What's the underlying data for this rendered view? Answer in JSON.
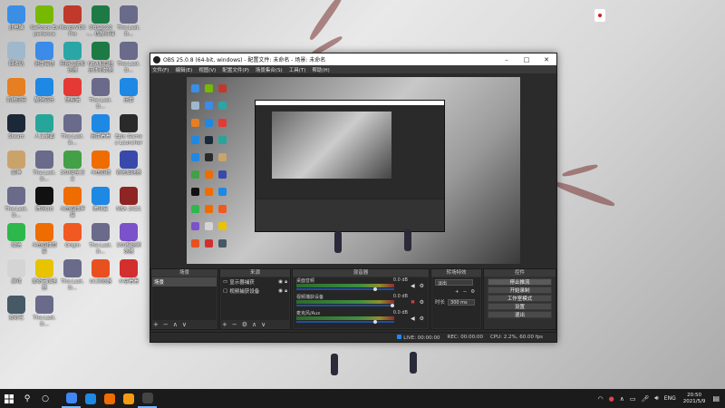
{
  "desktop": {
    "icons": [
      {
        "label": "此电脑",
        "icon": "computer-icon",
        "color": "#3a8ee6"
      },
      {
        "label": "GeForce Experience",
        "icon": "geforce-icon",
        "color": "#76b900"
      },
      {
        "label": "MorphVOX Pro",
        "icon": "morphvox-icon",
        "color": "#c0392b"
      },
      {
        "label": "OBS2020-... 优酷订阅",
        "icon": "excel-icon",
        "color": "#1d7a45"
      },
      {
        "label": "The.Last.D...",
        "icon": "file-icon",
        "color": "#6a6a8a"
      },
      {
        "label": "回收站",
        "icon": "recycle-bin-icon",
        "color": "#9fb8cc"
      },
      {
        "label": "迅雷云盘",
        "icon": "cloud-drive-icon",
        "color": "#3b8be8"
      },
      {
        "label": "阿斯力法加速器",
        "icon": "accelerator-icon",
        "color": "#2aa6a6"
      },
      {
        "label": "NBA和其他 正体测数据",
        "icon": "excel-icon",
        "color": "#1d7a45"
      },
      {
        "label": "The.Last.D...",
        "icon": "file-icon",
        "color": "#6a6a8a"
      },
      {
        "label": "系统应用",
        "icon": "system-apps-icon",
        "color": "#e67e22"
      },
      {
        "label": "酷狗音乐",
        "icon": "kugou-icon",
        "color": "#1e88e5"
      },
      {
        "label": "快剪辑",
        "icon": "video-edit-icon",
        "color": "#e53935"
      },
      {
        "label": "The.Last.D...",
        "icon": "file-icon",
        "color": "#6a6a8a"
      },
      {
        "label": "迅雷",
        "icon": "xunlei-icon",
        "color": "#1e88e5"
      },
      {
        "label": "Steam",
        "icon": "steam-icon",
        "color": "#1b2838"
      },
      {
        "label": "人工桌面",
        "icon": "desktop-theme-icon",
        "color": "#26a69a"
      },
      {
        "label": "The.Last.D...",
        "icon": "file-icon",
        "color": "#6a6a8a"
      },
      {
        "label": "迅雷看看",
        "icon": "xunlei-player-icon",
        "color": "#1e88e5"
      },
      {
        "label": "Epic Games Launcher",
        "icon": "epic-icon",
        "color": "#2a2a2a"
      },
      {
        "label": "原神",
        "icon": "genshin-icon",
        "color": "#caa36b"
      },
      {
        "label": "The.Last.D...",
        "icon": "file-icon",
        "color": "#6a6a8a"
      },
      {
        "label": "360安全卫士",
        "icon": "security-icon",
        "color": "#43a047"
      },
      {
        "label": "斗鱼直播",
        "icon": "douyu-icon",
        "color": "#ef6c00"
      },
      {
        "label": "奇迹加速器",
        "icon": "accelerator-icon",
        "color": "#3949ab"
      },
      {
        "label": "The.Last.D...",
        "icon": "file-icon",
        "color": "#6a6a8a"
      },
      {
        "label": "腾讯QQ",
        "icon": "qq-icon",
        "color": "#111111"
      },
      {
        "label": "斗鱼直播伴侣",
        "icon": "douyu-icon",
        "color": "#ef6c00"
      },
      {
        "label": "腾讯云",
        "icon": "cloud-icon",
        "color": "#1e88e5"
      },
      {
        "label": "NBA 2K21",
        "icon": "nba2k-icon",
        "color": "#8e2424"
      },
      {
        "label": "微信",
        "icon": "wechat-icon",
        "color": "#2db84b"
      },
      {
        "label": "斗鱼直播管家",
        "icon": "douyu-icon",
        "color": "#ef6c00"
      },
      {
        "label": "Origin",
        "icon": "origin-icon",
        "color": "#f05a22"
      },
      {
        "label": "The.Last.D...",
        "icon": "file-icon",
        "color": "#6a6a8a"
      },
      {
        "label": "360极速浏览器",
        "icon": "browser-icon",
        "color": "#7b52c9"
      },
      {
        "label": "游戏",
        "icon": "game-icon",
        "color": "#d4d4d4"
      },
      {
        "label": "爱奇艺加速器",
        "icon": "accelerator-icon",
        "color": "#e8c300"
      },
      {
        "label": "The.Last.D...",
        "icon": "file-icon",
        "color": "#6a6a8a"
      },
      {
        "label": "UC浏览器",
        "icon": "uc-browser-icon",
        "color": "#e9501f"
      },
      {
        "label": "小豆看看",
        "icon": "media-icon",
        "color": "#d32f2f"
      },
      {
        "label": "爱奇艺",
        "icon": "iqiyi-icon",
        "color": "#455a64"
      },
      {
        "label": "The.Last.D...",
        "icon": "file-icon",
        "color": "#6a6a8a"
      }
    ]
  },
  "obs": {
    "title": "OBS 25.0.8 (64-bit, windows) - 配置文件: 未命名 - 场景: 未命名",
    "menu": [
      "文件(F)",
      "编辑(E)",
      "视图(V)",
      "配置文件(P)",
      "场景集合(S)",
      "工具(T)",
      "帮助(H)"
    ],
    "docks": {
      "scenes": {
        "title": "场景",
        "items": [
          "场景"
        ]
      },
      "sources": {
        "title": "来源",
        "items": [
          {
            "label": "显示器捕获"
          },
          {
            "label": "视频捕获设备"
          }
        ]
      },
      "mixer": {
        "title": "混音器",
        "channels": [
          {
            "name": "桌面音频",
            "db": "0.0 dB",
            "muted": false,
            "level": 0.82
          },
          {
            "name": "视频捕获设备",
            "db": "0.0 dB",
            "muted": true,
            "level": 0.0
          },
          {
            "name": "麦克风/Aux",
            "db": "0.0 dB",
            "muted": false,
            "level": 0.82
          }
        ]
      },
      "transitions": {
        "title": "转场特效",
        "type": "淡出",
        "duration_label": "时长",
        "duration": "300 ms"
      },
      "controls": {
        "title": "控件",
        "buttons": [
          "停止推流",
          "开始录制",
          "工作室模式",
          "设置",
          "退出"
        ]
      }
    },
    "status": {
      "live_label": "LIVE:",
      "live_time": "00:00:00",
      "rec_label": "REC:",
      "rec_time": "00:00:00",
      "cpu": "CPU: 2.2%, 60.00 fps"
    }
  },
  "taskbar": {
    "apps": [
      {
        "icon": "chrome-icon",
        "color": "#4285f4",
        "active": true
      },
      {
        "icon": "kugou-icon",
        "color": "#1e88e5",
        "active": false
      },
      {
        "icon": "douyu-icon",
        "color": "#ef6c00",
        "active": false
      },
      {
        "icon": "douyu-helper-icon",
        "color": "#f39c12",
        "active": false
      },
      {
        "icon": "obs-icon",
        "color": "#444444",
        "active": true
      }
    ],
    "lang": "ENG",
    "time": "20:50",
    "date": "2021/5/9"
  }
}
